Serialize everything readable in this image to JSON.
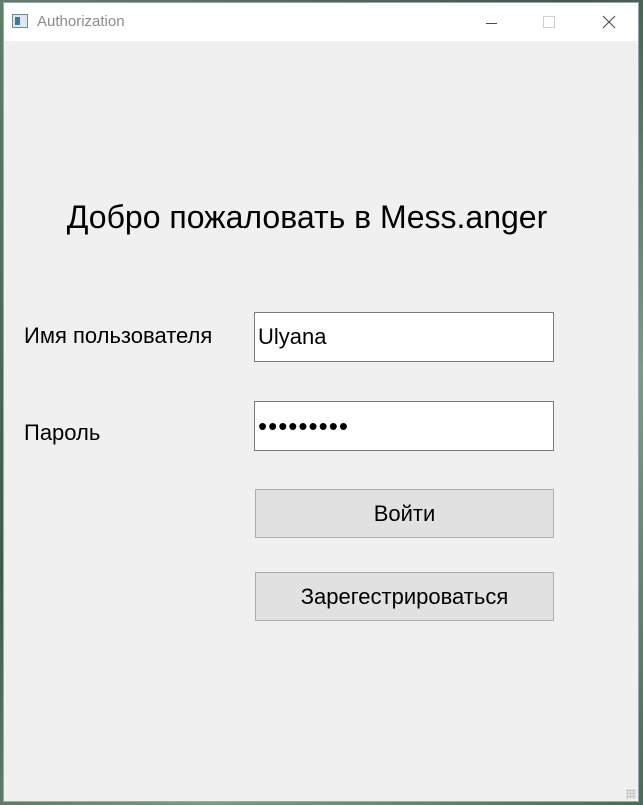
{
  "window": {
    "title": "Authorization"
  },
  "main": {
    "heading": "Добро пожаловать в Mess.anger",
    "username_label": "Имя пользователя",
    "username_value": "Ulyana",
    "password_label": "Пароль",
    "password_value": "•••••••••",
    "login_button": "Войти",
    "register_button": "Зарегестрироваться"
  }
}
